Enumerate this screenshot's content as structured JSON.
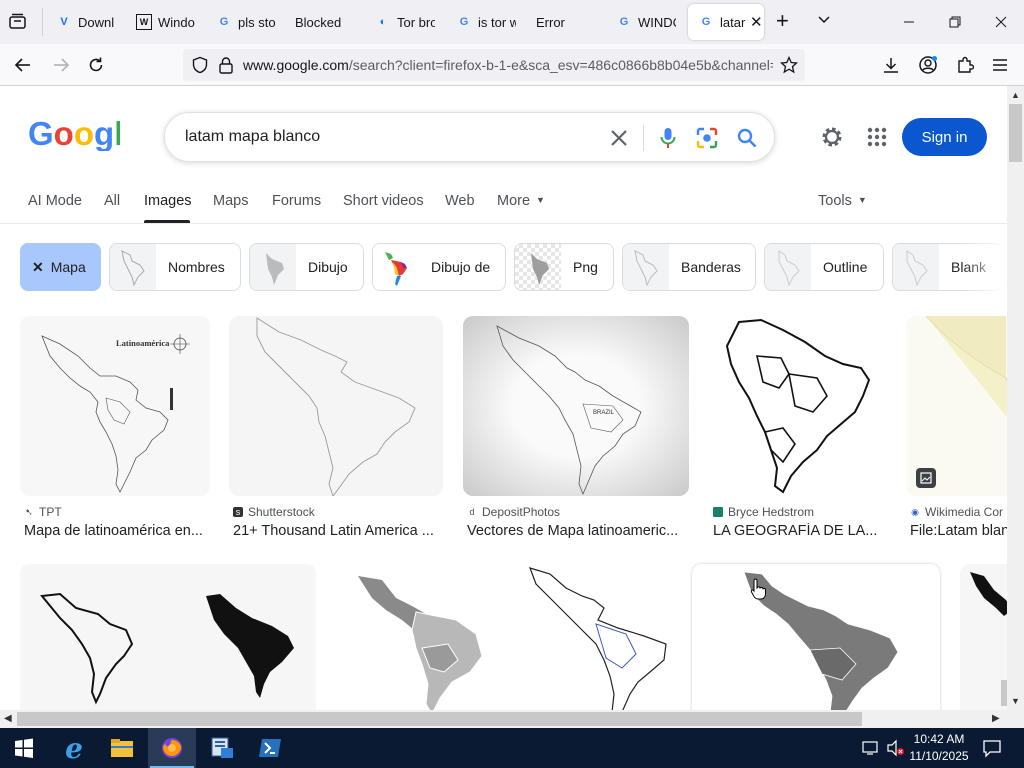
{
  "browser": {
    "tabs": [
      {
        "label": "Downl",
        "icon": "vevox-icon"
      },
      {
        "label": "Windo",
        "icon": "wiki-icon"
      },
      {
        "label": "pls sto",
        "icon": "google-icon"
      },
      {
        "label": "Blocked",
        "icon": "blank-icon"
      },
      {
        "label": "Tor bro",
        "icon": "tor-icon"
      },
      {
        "label": "is tor w",
        "icon": "google-icon"
      },
      {
        "label": "Error",
        "icon": "blank-icon"
      },
      {
        "label": "WINDC",
        "icon": "google-icon"
      },
      {
        "label": "latar",
        "icon": "google-icon",
        "active": true
      }
    ],
    "url_domain": "www.google.com",
    "url_rest": "/search?client=firefox-b-1-e&sca_esv=486c0866b8b04e5b&channel="
  },
  "search": {
    "query": "latam mapa blanco",
    "sign_in": "Sign in"
  },
  "nav_tabs": [
    "AI Mode",
    "All",
    "Images",
    "Maps",
    "Forums",
    "Short videos",
    "Web",
    "More",
    "Tools"
  ],
  "chips": [
    {
      "label": "Mapa",
      "selected": true
    },
    {
      "label": "Nombres"
    },
    {
      "label": "Dibujo"
    },
    {
      "label": "Dibujo de"
    },
    {
      "label": "Png"
    },
    {
      "label": "Banderas"
    },
    {
      "label": "Outline"
    },
    {
      "label": "Blank"
    }
  ],
  "results_row1": [
    {
      "source": "TPT",
      "title": "Mapa de latinoamérica en...",
      "map_label": "Latinoamérica"
    },
    {
      "source": "Shutterstock",
      "title": "21+ Thousand Latin America ..."
    },
    {
      "source": "DepositPhotos",
      "title": "Vectores de Mapa latinoameric...",
      "map_label": "BRAZIL"
    },
    {
      "source": "Bryce Hedstrom",
      "title": "LA GEOGRAFÍA DE LA..."
    },
    {
      "source": "Wikimedia Cor",
      "title": "File:Latam blan"
    }
  ],
  "taskbar": {
    "time": "10:42 AM",
    "date": "11/10/2025"
  },
  "colors": {
    "accent": "#0b57d0",
    "chip_selected": "#a8c7fa",
    "taskbar": "#0b1a33"
  }
}
